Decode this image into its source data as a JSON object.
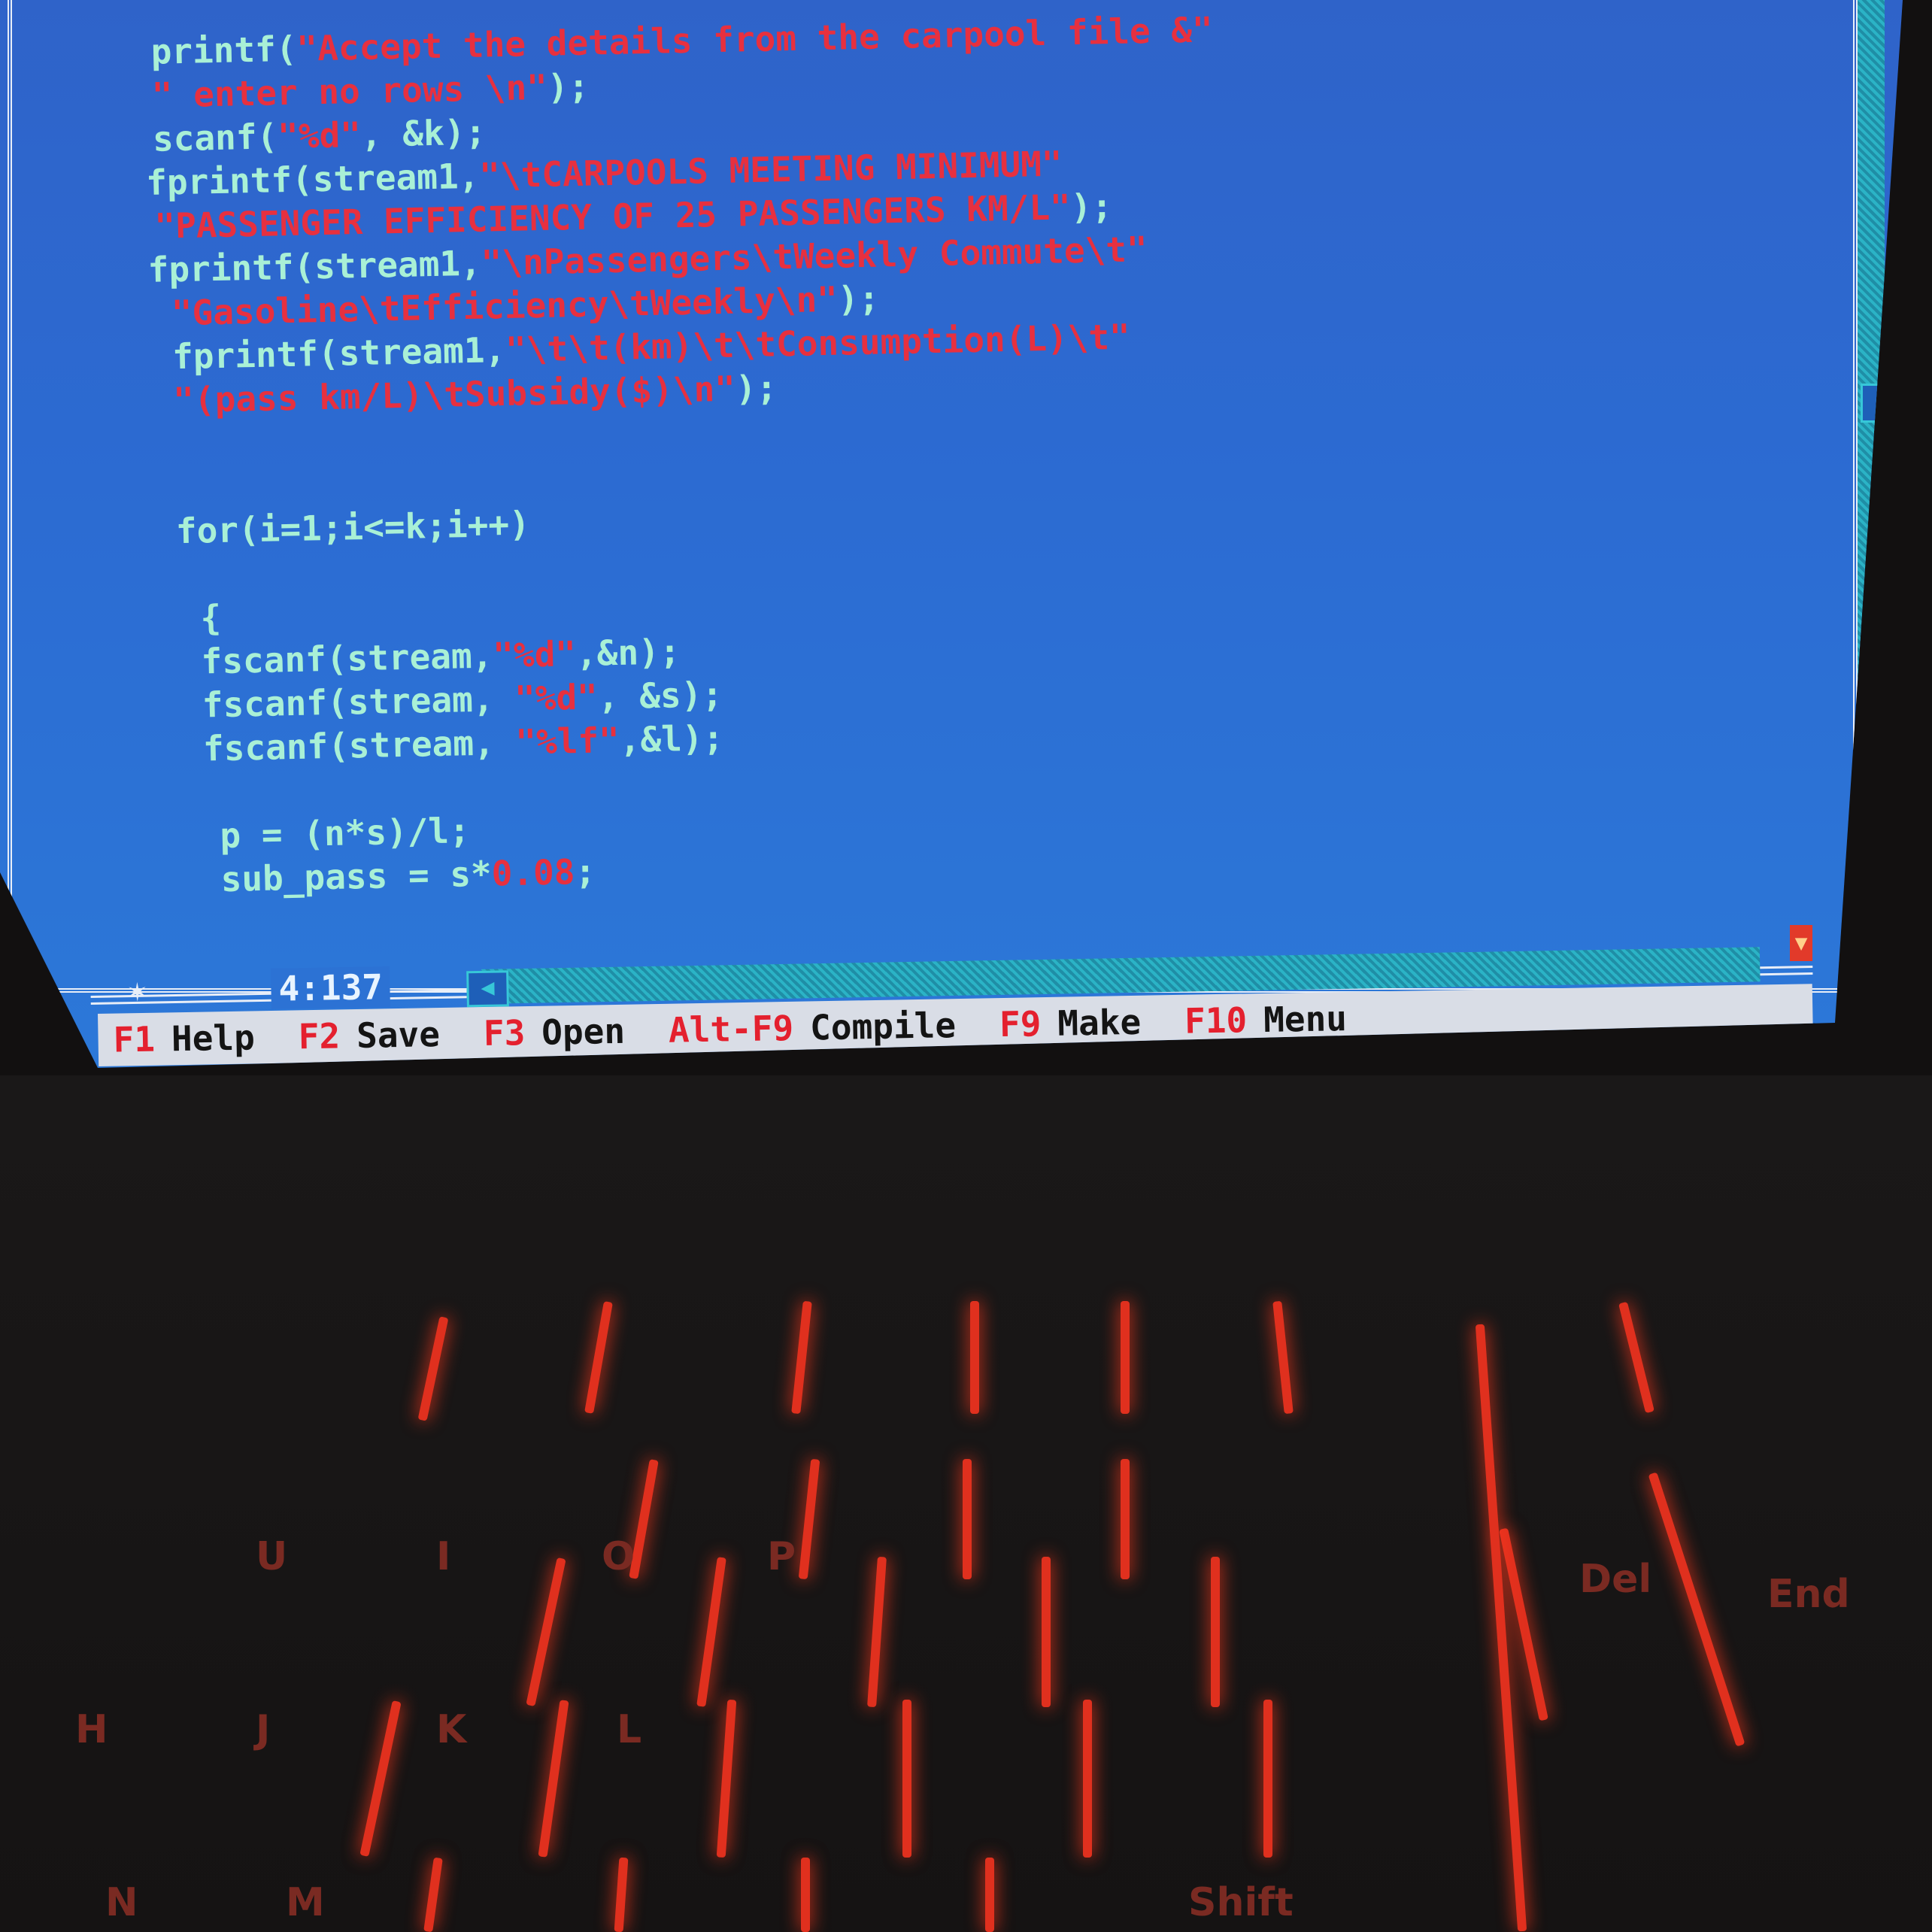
{
  "code_lines": [
    {
      "pre": "printf(",
      "str": "\"Accept the details from the carpool file &\"",
      "post": ""
    },
    {
      "pre": "",
      "str": "\" enter no rows \\n\"",
      "post": ");"
    },
    {
      "pre": "scanf(",
      "str": "\"%d\"",
      "post": ", &k);"
    },
    {
      "pre": "fprintf(stream1,",
      "str": "\"\\tCARPOOLS MEETING MINIMUM\"",
      "post": ""
    },
    {
      "pre": "",
      "str": "\"PASSENGER EFFICIENCY OF 25 PASSENGERS KM/L\"",
      "post": ");"
    },
    {
      "pre": "fprintf(stream1,",
      "str": "\"\\nPassengers\\tWeekly Commute\\t\"",
      "post": ""
    },
    {
      "pre": "",
      "str": "\"Gasoline\\tEfficiency\\tWeekly\\n\"",
      "post": ");"
    },
    {
      "pre": "fprintf(stream1,",
      "str": "\"\\t\\t(km)\\t\\tConsumption(L)\\t\"",
      "post": ""
    },
    {
      "pre": "",
      "str": "\"(pass km/L)\\tSubsidy($)\\n\"",
      "post": ");"
    },
    {
      "pre": "for(i=1;i<=k;i++)",
      "str": "",
      "post": ""
    },
    {
      "pre": "{",
      "str": "",
      "post": ""
    },
    {
      "pre": "fscanf(stream,",
      "str": "\"%d\"",
      "post": ",&n);"
    },
    {
      "pre": "fscanf(stream, ",
      "str": "\"%d\"",
      "post": ", &s);"
    },
    {
      "pre": "fscanf(stream, ",
      "str": "\"%lf\"",
      "post": ",&l);"
    },
    {
      "pre": "p = (n*s)/l;",
      "str": "",
      "post": ""
    },
    {
      "pre": "sub_pass = s*",
      "str": "0.08",
      "post": ";"
    }
  ],
  "status": {
    "cursor_position": "4:137"
  },
  "menu": [
    {
      "key": "F1",
      "label": "Help"
    },
    {
      "key": "F2",
      "label": "Save"
    },
    {
      "key": "F3",
      "label": "Open"
    },
    {
      "key": "Alt-F9",
      "label": "Compile"
    },
    {
      "key": "F9",
      "label": "Make"
    },
    {
      "key": "F10",
      "label": "Menu"
    }
  ],
  "keyboard_labels": [
    "U",
    "I",
    "O",
    "P",
    "H",
    "J",
    "K",
    "L",
    "N",
    "M",
    "Shift",
    "Del",
    "End"
  ],
  "colors": {
    "editor_bg": "#2f63c9",
    "code_text": "#a9f0d6",
    "string_text": "#e7303f",
    "menu_bg": "#d9dde6",
    "hotkey": "#e4202e",
    "key_backlight": "#e0301e"
  }
}
